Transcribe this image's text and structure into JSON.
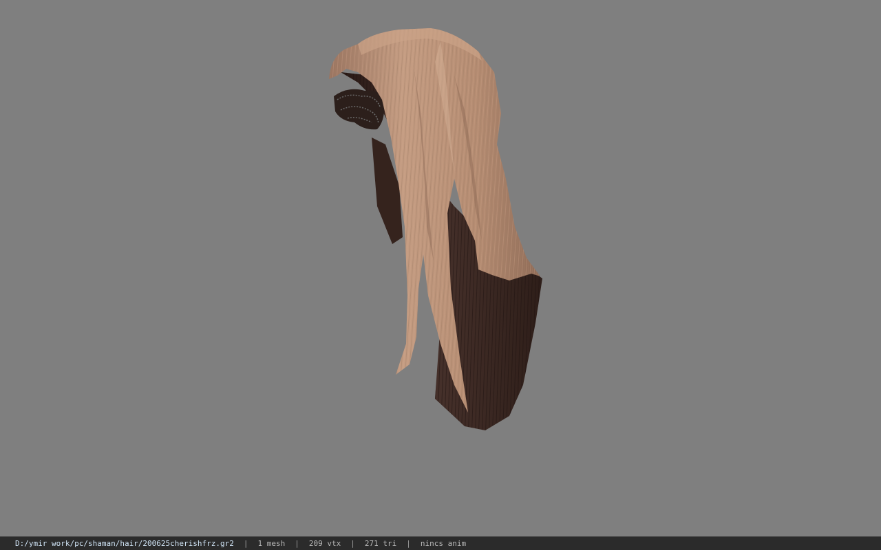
{
  "viewport": {
    "background": "#7f7f7f",
    "model": {
      "subject": "hair-mesh",
      "hair_color": "#b08a72",
      "hair_highlight": "#c89e84",
      "underside_color": "#3a2620"
    }
  },
  "statusbar": {
    "file_path": "D:/ymir work/pc/shaman/hair/200625cherishfrz.gr2",
    "separator": "|",
    "mesh": "1 mesh",
    "vtx": "209 vtx",
    "tri": "271 tri",
    "anim": "nincs anim"
  }
}
